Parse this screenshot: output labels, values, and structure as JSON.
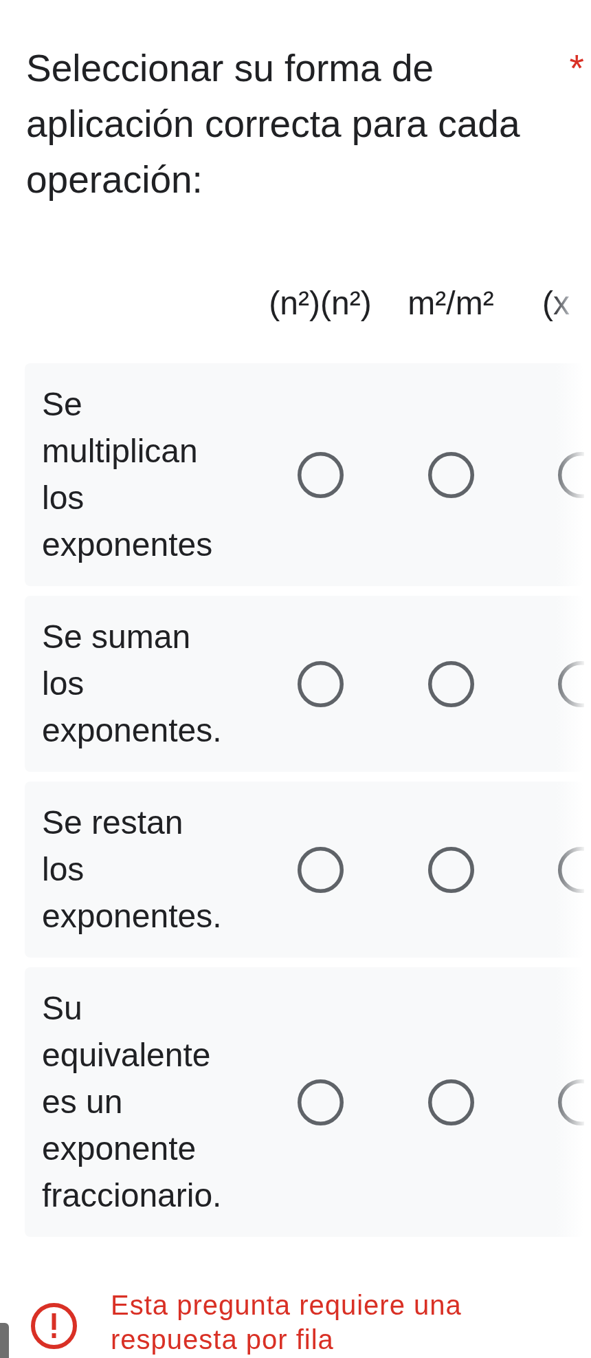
{
  "question": {
    "title": "Seleccionar su forma de aplicación correcta para cada operación:",
    "required_mark": "*"
  },
  "columns": [
    "(n²)(n²)",
    "m²/m²",
    "(x"
  ],
  "rows": [
    {
      "label": "Se multiplican los exponentes",
      "options": [
        {
          "selected": false
        },
        {
          "selected": false
        },
        {
          "selected": false
        }
      ]
    },
    {
      "label": "Se suman los exponentes.",
      "options": [
        {
          "selected": false
        },
        {
          "selected": false
        },
        {
          "selected": false
        }
      ]
    },
    {
      "label": "Se restan los exponentes.",
      "options": [
        {
          "selected": false
        },
        {
          "selected": false
        },
        {
          "selected": false
        }
      ]
    },
    {
      "label": "Su equivalente es un exponente fraccionario.",
      "options": [
        {
          "selected": false
        },
        {
          "selected": false
        },
        {
          "selected": false
        }
      ]
    }
  ],
  "error": {
    "message": "Esta pregunta requiere una respuesta por fila"
  }
}
